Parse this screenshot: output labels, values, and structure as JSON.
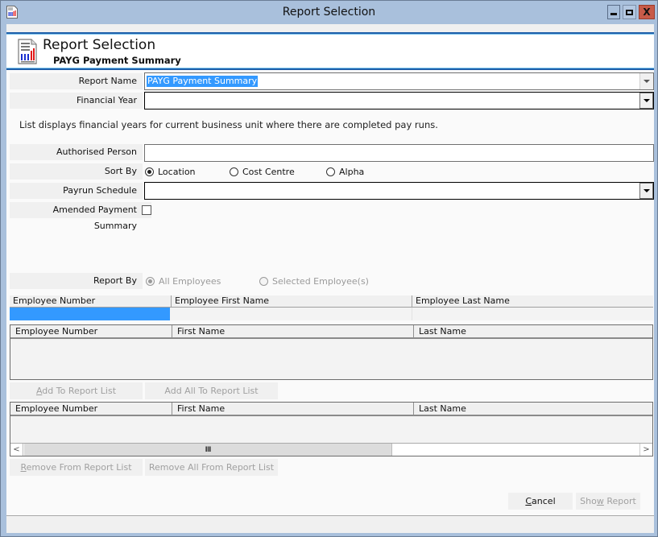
{
  "window": {
    "title": "Report Selection",
    "icon": "report-chart-icon",
    "controls": {
      "minimize": "minimize-icon",
      "maximize": "maximize-icon",
      "close": "X"
    }
  },
  "header": {
    "title": "Report Selection",
    "subtitle": "PAYG Payment Summary",
    "icon": "report-chart-icon"
  },
  "form": {
    "report_name": {
      "label": "Report Name",
      "value": "PAYG Payment Summary"
    },
    "financial_year": {
      "label": "Financial Year",
      "value": ""
    },
    "info_text": "List displays financial years for current business unit where there are completed pay runs.",
    "authorised_person": {
      "label": "Authorised Person",
      "value": ""
    },
    "sort_by": {
      "label": "Sort By",
      "options": [
        "Location",
        "Cost Centre",
        "Alpha"
      ],
      "selected": "Location"
    },
    "payrun_schedule": {
      "label": "Payrun Schedule",
      "value": ""
    },
    "amended_payment_summary": {
      "label": "Amended Payment Summary",
      "checked": false
    },
    "report_by": {
      "label": "Report By",
      "options": [
        "All Employees",
        "Selected Employee(s)"
      ],
      "selected": "All Employees",
      "disabled": true
    }
  },
  "filter_grid": {
    "columns": [
      "Employee Number",
      "Employee First Name",
      "Employee Last Name"
    ]
  },
  "available_list": {
    "columns": [
      "Employee Number",
      "First Name",
      "Last Name"
    ],
    "rows": []
  },
  "add_buttons": {
    "add": "Add To Report List",
    "add_mnemonic": "A",
    "add_rest": "dd To Report List",
    "add_all": "Add All To Report List"
  },
  "report_list": {
    "columns": [
      "Employee Number",
      "First Name",
      "Last Name"
    ],
    "rows": [],
    "scrollbar": {
      "left": "<",
      "right": ">",
      "thumb": "III"
    }
  },
  "remove_buttons": {
    "remove_mnemonic": "R",
    "remove_rest": "emove From Report List",
    "remove_all": "Remove All From Report List"
  },
  "footer": {
    "cancel_mnemonic": "C",
    "cancel_rest": "ancel",
    "show_pre": "Sho",
    "show_mnemonic": "w",
    "show_rest": " Report"
  }
}
